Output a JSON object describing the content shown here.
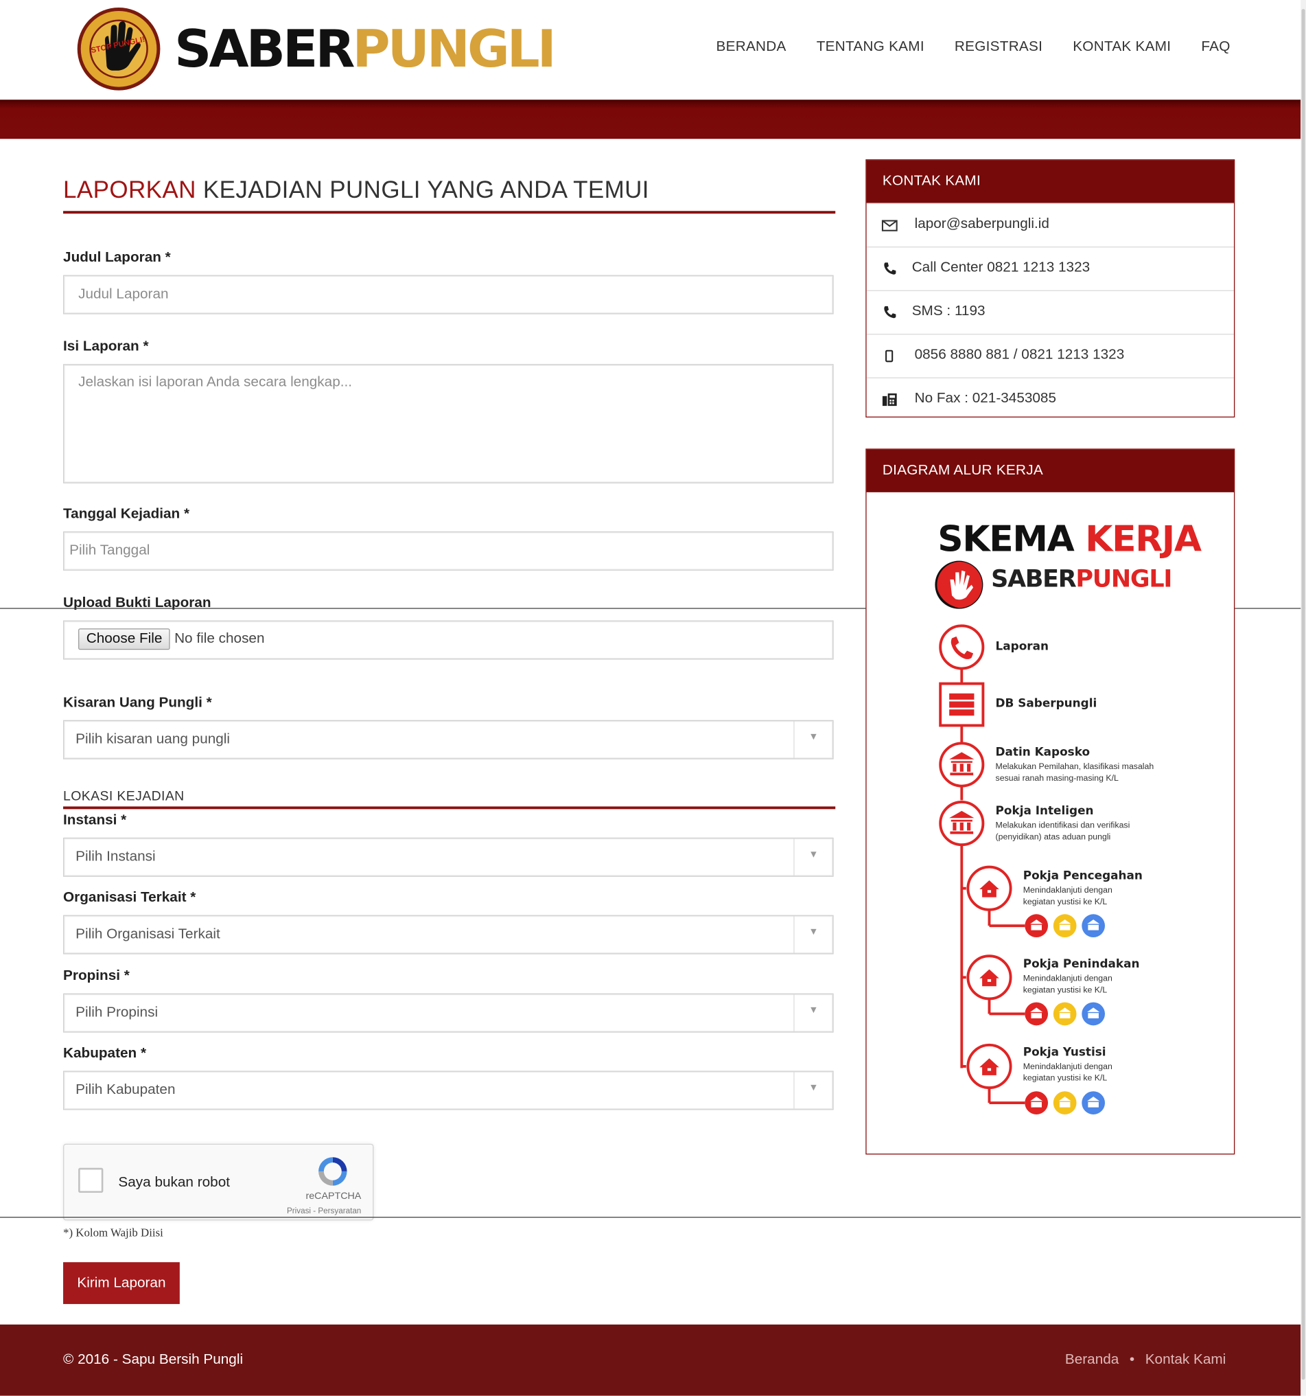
{
  "brand": {
    "part1": "SABER",
    "part2": "PUNGLI",
    "badge_text": "STOP PUNGLI!",
    "badge_ring": "SATGAS SABER PUNGLI"
  },
  "nav": {
    "items": [
      "BERANDA",
      "TENTANG KAMI",
      "REGISTRASI",
      "KONTAK KAMI",
      "FAQ"
    ]
  },
  "form": {
    "title_highlight": "LAPORKAN",
    "title_rest": " KEJADIAN PUNGLI YANG ANDA TEMUI",
    "judul_label": "Judul Laporan *",
    "judul_placeholder": "Judul Laporan",
    "isi_label": "Isi Laporan *",
    "isi_placeholder": "Jelaskan isi laporan Anda secara lengkap...",
    "tanggal_label": "Tanggal Kejadian *",
    "tanggal_placeholder": "Pilih Tanggal",
    "upload_label": "Upload Bukti Laporan",
    "choose_file": "Choose File",
    "no_file": "No file chosen",
    "kisaran_label": "Kisaran Uang Pungli *",
    "kisaran_placeholder": "Pilih kisaran uang pungli",
    "lokasi_heading": "LOKASI KEJADIAN",
    "instansi_label": "Instansi *",
    "instansi_placeholder": "Pilih Instansi",
    "organisasi_label": "Organisasi Terkait *",
    "organisasi_placeholder": "Pilih Organisasi Terkait",
    "propinsi_label": "Propinsi *",
    "propinsi_placeholder": "Pilih Propinsi",
    "kabupaten_label": "Kabupaten *",
    "kabupaten_placeholder": "Pilih Kabupaten",
    "captcha_text": "Saya bukan robot",
    "captcha_brand": "reCAPTCHA",
    "captcha_links": "Privasi - Persyaratan",
    "required_note": "*) Kolom Wajib Diisi",
    "submit_label": "Kirim Laporan"
  },
  "sidebar": {
    "contact_title": "KONTAK KAMI",
    "contacts": [
      {
        "icon": "envelope-icon",
        "text": "lapor@saberpungli.id"
      },
      {
        "icon": "phone-icon",
        "text": "Call Center 0821 1213 1323"
      },
      {
        "icon": "phone-icon",
        "text": "SMS : 1193"
      },
      {
        "icon": "mobile-icon",
        "text": "0856 8880 881 / 0821 1213 1323"
      },
      {
        "icon": "fax-icon",
        "text": "No Fax : 021-3453085"
      }
    ],
    "diagram_title": "DIAGRAM ALUR KERJA",
    "diagram": {
      "skema1": "SKEMA ",
      "skema2": "KERJA",
      "sp1": "SABER",
      "sp2": "PUNGLI",
      "steps": [
        {
          "title": "Laporan",
          "sub": ""
        },
        {
          "title": "DB Saberpungli",
          "sub": ""
        },
        {
          "title": "Datin Kaposko",
          "sub": "Melakukan Pemilahan, klasifikasi masalah sesuai ranah masing-masing K/L"
        },
        {
          "title": "Pokja Inteligen",
          "sub": "Melakukan identifikasi dan verifikasi (penyidikan) atas aduan pungli"
        },
        {
          "title": "Pokja Pencegahan",
          "sub": "Menindaklanjuti dengan kegiatan yustisi ke K/L"
        },
        {
          "title": "Pokja Penindakan",
          "sub": "Menindaklanjuti dengan kegiatan yustisi ke K/L"
        },
        {
          "title": "Pokja Yustisi",
          "sub": "Menindaklanjuti dengan kegiatan yustisi ke K/L"
        }
      ]
    }
  },
  "footer": {
    "copyright": "© 2016 - Sapu Bersih Pungli",
    "link1": "Beranda",
    "sep": "•",
    "link2": "Kontak Kami"
  },
  "colors": {
    "primary": "#760a0a",
    "accent": "#a3191c",
    "gold": "#d7a23a",
    "diagram_red": "#e02424"
  }
}
